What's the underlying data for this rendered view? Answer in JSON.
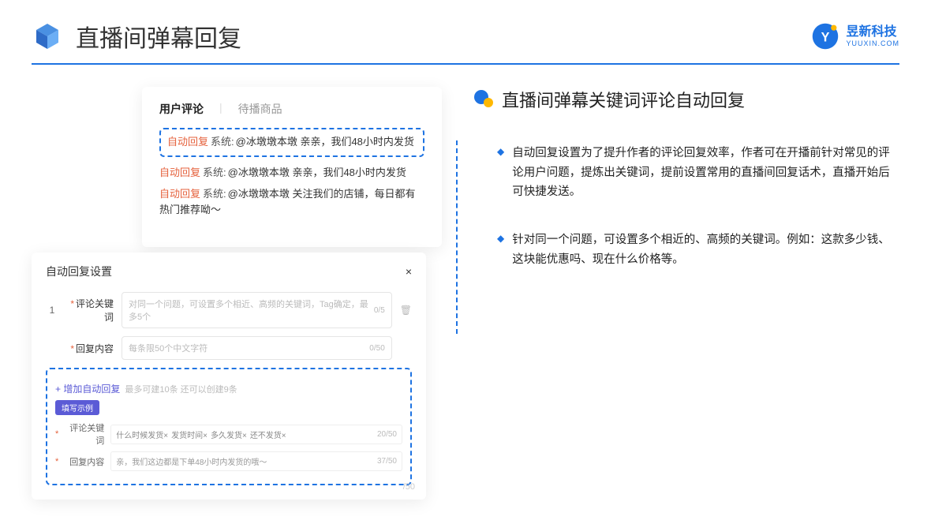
{
  "header": {
    "title": "直播间弹幕回复"
  },
  "brand": {
    "cn": "昱新科技",
    "en": "YUUXIN.COM"
  },
  "comments": {
    "tabs": [
      "用户评论",
      "待播商品"
    ],
    "highlighted": {
      "tag": "自动回复",
      "sys": "系统:",
      "text": "@冰墩墩本墩 亲亲，我们48小时内发货"
    },
    "others": [
      {
        "tag": "自动回复",
        "sys": "系统:",
        "text": "@冰墩墩本墩 亲亲，我们48小时内发货"
      },
      {
        "tag": "自动回复",
        "sys": "系统:",
        "text": "@冰墩墩本墩 关注我们的店铺，每日都有热门推荐呦～"
      }
    ]
  },
  "settings": {
    "title": "自动回复设置",
    "num": "1",
    "f1": {
      "label": "评论关键词",
      "ph": "对同一个问题，可设置多个相近、高频的关键词，Tag确定，最多5个",
      "count": "0/5"
    },
    "f2": {
      "label": "回复内容",
      "ph": "每条限50个中文字符",
      "count": "0/50"
    },
    "add": "+ 增加自动回复",
    "hint": "最多可建10条 还可以创建9条",
    "badge": "填写示例",
    "ex1": {
      "label": "评论关键词",
      "tags": [
        "什么时候发货×",
        "发货时间×",
        "多久发货×",
        "还不发货×"
      ],
      "count": "20/50"
    },
    "ex2": {
      "label": "回复内容",
      "text": "亲，我们这边都是下单48小时内发货的哦～",
      "count": "37/50"
    },
    "bottom50": "/50"
  },
  "right": {
    "title": "直播间弹幕关键词评论自动回复",
    "b1": "自动回复设置为了提升作者的评论回复效率，作者可在开播前针对常见的评论用户问题，提炼出关键词，提前设置常用的直播间回复话术，直播开始后可快捷发送。",
    "b2": "针对同一个问题，可设置多个相近的、高频的关键词。例如：这款多少钱、这块能优惠吗、现在什么价格等。"
  }
}
